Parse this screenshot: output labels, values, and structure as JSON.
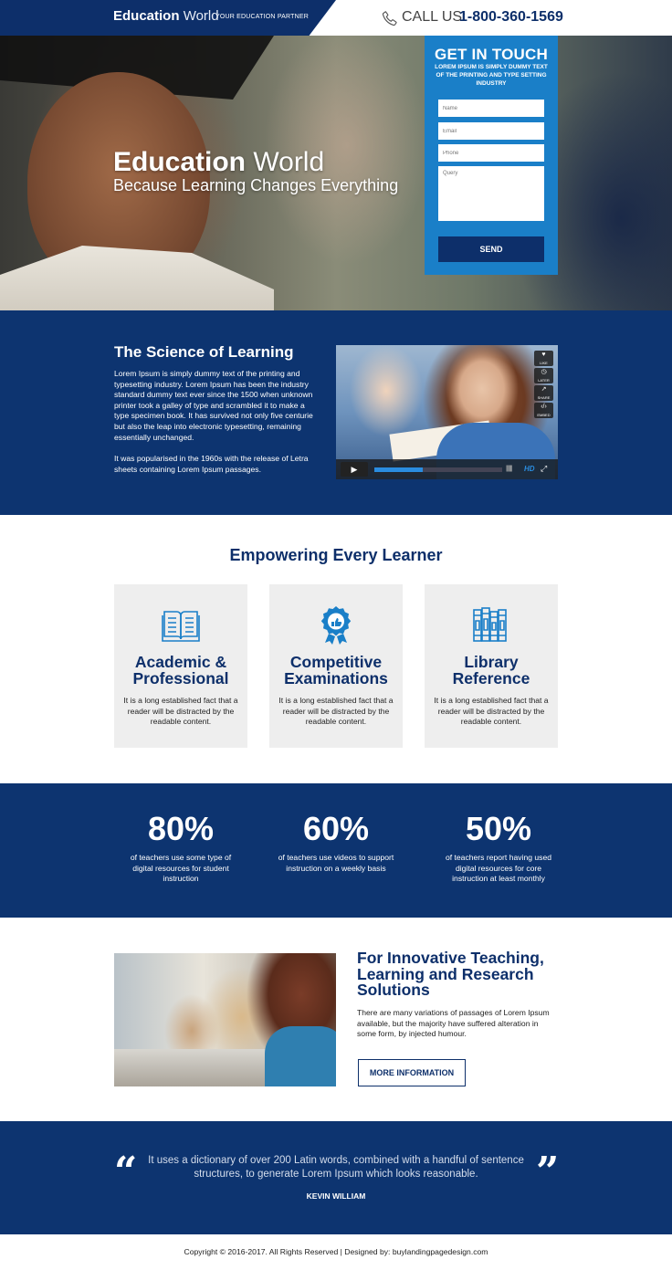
{
  "header": {
    "logo_bold": "Education",
    "logo_light": "World",
    "tagline": "YOUR EDUCATION PARTNER",
    "call_label": "CALL US:",
    "call_number": "1-800-360-1569"
  },
  "hero": {
    "title_bold": "Education",
    "title_light": "World",
    "subtitle": "Because Learning Changes Everything"
  },
  "form": {
    "title": "GET IN TOUCH",
    "subtitle": "LOREM IPSUM IS SIMPLY DUMMY TEXT OF THE PRINTING AND TYPE SETTING INDUSTRY",
    "name_placeholder": "Name",
    "email_placeholder": "Email",
    "phone_placeholder": "Phone",
    "query_placeholder": "Query",
    "send_label": "SEND"
  },
  "science": {
    "title": "The Science of Learning",
    "para1": "Lorem Ipsum is simply dummy text of the printing and typesetting industry. Lorem Ipsum has been the industry standard dummy text ever since the 1500 when unknown printer took a galley of type and scrambled it to make a type specimen book. It has survived not only five centurie but also the leap into electronic typesetting, remaining essentially unchanged.",
    "para2": "It was popularised in the 1960s with the release of Letra sheets containing Lorem Ipsum passages.",
    "video": {
      "like": "LIKE",
      "later": "LATER",
      "share": "SHARE",
      "embed": "EMBED",
      "hd": "HD",
      "progress": 0.38
    }
  },
  "empowering": {
    "title": "Empowering Every Learner",
    "cards": [
      {
        "title_line1": "Academic &",
        "title_line2": "Professional",
        "text": "It is a long established fact that a reader will be distracted by the readable content.",
        "icon": "open-book-icon"
      },
      {
        "title_line1": "Competitive",
        "title_line2": "Examinations",
        "text": "It is a long established fact that a reader will be distracted by the readable content.",
        "icon": "award-badge-icon"
      },
      {
        "title_line1": "Library",
        "title_line2": "Reference",
        "text": "It is a long established fact that a reader will be distracted by the readable content.",
        "icon": "books-shelf-icon"
      }
    ]
  },
  "stats": [
    {
      "value": "80%",
      "text": "of teachers use some type of digital resources for student instruction"
    },
    {
      "value": "60%",
      "text": "of teachers use videos to support instruction on a weekly basis"
    },
    {
      "value": "50%",
      "text": "of teachers report having used digital resources for core instruction at least monthly"
    }
  ],
  "innovative": {
    "title": "For Innovative Teaching, Learning and Research Solutions",
    "text": "There are many variations of passages of Lorem Ipsum available, but the majority have suffered alteration in some form, by injected humour.",
    "button": "MORE INFORMATION"
  },
  "testimonial": {
    "quote": "It uses a dictionary of over 200 Latin words, combined with a handful of  sentence structures, to generate Lorem Ipsum which looks reasonable.",
    "author": "KEVIN WILLIAM",
    "open_mark": "“",
    "close_mark": "”"
  },
  "footer": {
    "text": "Copyright © 2016-2017. All Rights Reserved  |  Designed by: buylandingpagedesign.com"
  },
  "colors": {
    "navy": "#0d3470",
    "accent_blue": "#1a7fc8",
    "card_bg": "#eeeeee"
  }
}
